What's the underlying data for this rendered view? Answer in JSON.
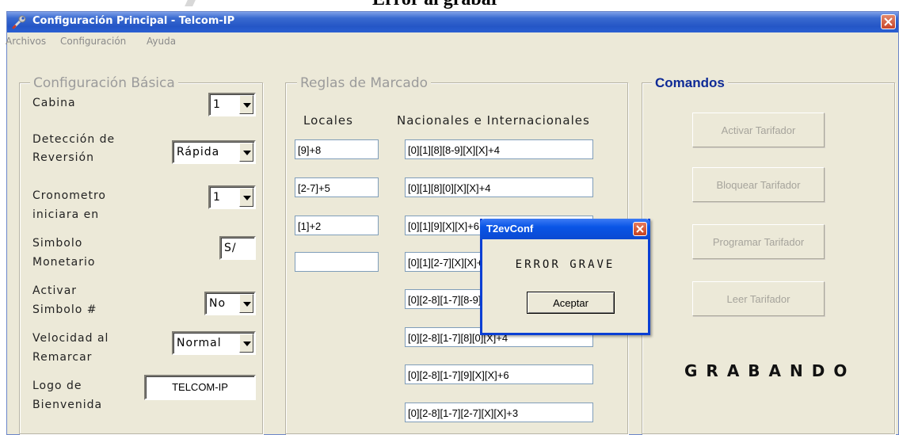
{
  "document": {
    "heading": "Error al grabar"
  },
  "window": {
    "title": "Configuración Principal - Telcom-IP"
  },
  "menu": [
    "Archivos",
    "Configuración",
    "Ayuda"
  ],
  "basic": {
    "legend": "Configuración Básica",
    "cabina": {
      "label": "Cabina",
      "value": "1"
    },
    "deteccion": {
      "label_line1": "Detección de",
      "label_line2": "Reversión",
      "value": "Rápida"
    },
    "cronometro": {
      "label_line1": "Cronometro",
      "label_line2": "iniciara en",
      "value": "1"
    },
    "simbolo": {
      "label_line1": "Simbolo",
      "label_line2": "Monetario",
      "value": "S/"
    },
    "activar": {
      "label_line1": "Activar",
      "label_line2": "Simbolo #",
      "value": "No"
    },
    "velocidad": {
      "label_line1": "Velocidad al",
      "label_line2": "Remarcar",
      "value": "Normal"
    },
    "logo": {
      "label_line1": "Logo de",
      "label_line2": "Bienvenida",
      "value": "TELCOM-IP"
    }
  },
  "dialing": {
    "legend": "Reglas de Marcado",
    "locales_header": "Locales",
    "nacionales_header": "Nacionales e Internacionales",
    "locales": [
      "[9]+8",
      "[2-7]+5",
      "[1]+2",
      ""
    ],
    "nacionales": [
      "[0][1][8][8-9][X][X]+4",
      "[0][1][8][0][X][X]+4",
      "[0][1][9][X][X]+6",
      "[0][1][2-7][X][X]+3",
      "[0][2-8][1-7][8-9][X][X]+4",
      "[0][2-8][1-7][8][0][X]+4",
      "[0][2-8][1-7][9][X][X]+6",
      "[0][2-8][1-7][2-7][X][X]+3"
    ]
  },
  "commands": {
    "legend": "Comandos",
    "buttons": [
      "Activar Tarifador",
      "Bloquear Tarifador",
      "Programar Tarifador",
      "Leer Tarifador"
    ],
    "status": "GRABANDO"
  },
  "dialog": {
    "title": "T2evConf",
    "message": "ERROR GRAVE",
    "ok_label": "Aceptar"
  },
  "colors": {
    "titlebar": "#2456c6",
    "window_bg": "#ece9d8",
    "legend_active": "#0e2a96"
  }
}
